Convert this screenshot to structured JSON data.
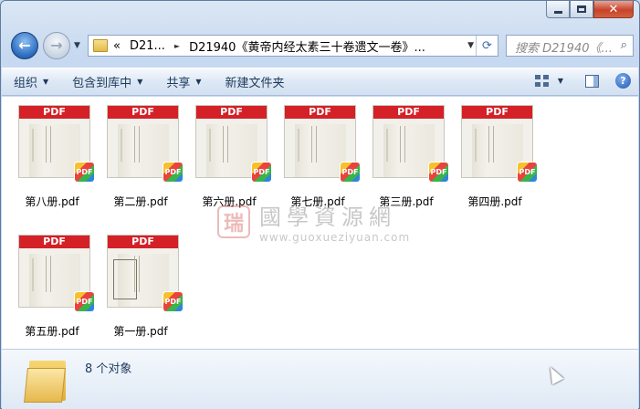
{
  "window": {
    "minimize_symbol": "",
    "close_symbol": "✕"
  },
  "nav": {
    "back_symbol": "←",
    "forward_symbol": "→",
    "recent_symbol": "▼"
  },
  "address": {
    "prefix": "«",
    "segments": [
      "D21...",
      "D21940《黄帝内经太素三十卷遗文一卷》..."
    ],
    "separator": "►",
    "dropdown": "▼",
    "refresh": "⟳"
  },
  "search": {
    "placeholder": "搜索 D21940《...",
    "icon": "search-icon"
  },
  "toolbar": {
    "organize": "组织",
    "include_in_library": "包含到库中",
    "share": "共享",
    "new_folder": "新建文件夹",
    "dropdown_symbol": "▼",
    "help_symbol": "?"
  },
  "files": [
    {
      "name": "第八册.pdf",
      "thumb_label": "PDF",
      "badge": "PDF"
    },
    {
      "name": "第二册.pdf",
      "thumb_label": "PDF",
      "badge": "PDF"
    },
    {
      "name": "第六册.pdf",
      "thumb_label": "PDF",
      "badge": "PDF"
    },
    {
      "name": "第七册.pdf",
      "thumb_label": "PDF",
      "badge": "PDF"
    },
    {
      "name": "第三册.pdf",
      "thumb_label": "PDF",
      "badge": "PDF"
    },
    {
      "name": "第四册.pdf",
      "thumb_label": "PDF",
      "badge": "PDF"
    },
    {
      "name": "第五册.pdf",
      "thumb_label": "PDF",
      "badge": "PDF"
    },
    {
      "name": "第一册.pdf",
      "thumb_label": "PDF",
      "badge": "PDF"
    }
  ],
  "watermark": {
    "logo": "瑞",
    "text": "國學資源網",
    "url": "www.guoxueziyuan.com"
  },
  "status": {
    "item_count": "8 个对象"
  },
  "colors": {
    "pdf_red": "#d42027",
    "accent_blue": "#1e395b"
  }
}
